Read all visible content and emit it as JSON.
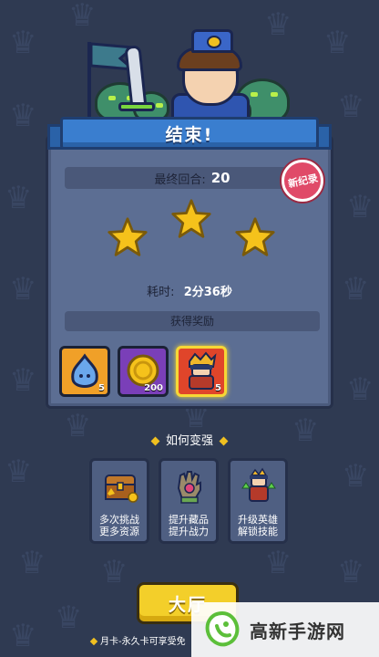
{
  "result": {
    "title": "结束!",
    "final_round_label": "最终回合:",
    "final_round_value": "20",
    "new_record_badge": "新纪录",
    "stars_earned": 3,
    "stars_total": 3,
    "time_label": "耗时:",
    "time_value": "2分36秒",
    "rewards_header": "获得奖励"
  },
  "rewards": [
    {
      "icon": "blue-slime-icon",
      "count": "5",
      "bg": "#f0a028"
    },
    {
      "icon": "gold-coin-icon",
      "count": "200",
      "bg": "#7a3fb8"
    },
    {
      "icon": "hero-card-icon",
      "count": "5",
      "bg": "#e0452a"
    }
  ],
  "stronger": {
    "title": "如何变强",
    "tips": [
      {
        "icon": "treasure-chest-icon",
        "line1": "多次挑战",
        "line2": "更多资源"
      },
      {
        "icon": "relic-gauntlet-icon",
        "line1": "提升藏品",
        "line2": "提升战力"
      },
      {
        "icon": "upgrade-hero-icon",
        "line1": "升级英雄",
        "line2": "解锁技能"
      }
    ]
  },
  "lobby_button": "大厅",
  "footer_note": "月卡-永久卡可享受免",
  "watermark": {
    "text": "高新手游网"
  },
  "colors": {
    "background": "#2f3a52",
    "panel": "#5c6e93",
    "ribbon": "#3a7ecf",
    "star": "#f5c21b",
    "button": "#f3cf2a"
  }
}
